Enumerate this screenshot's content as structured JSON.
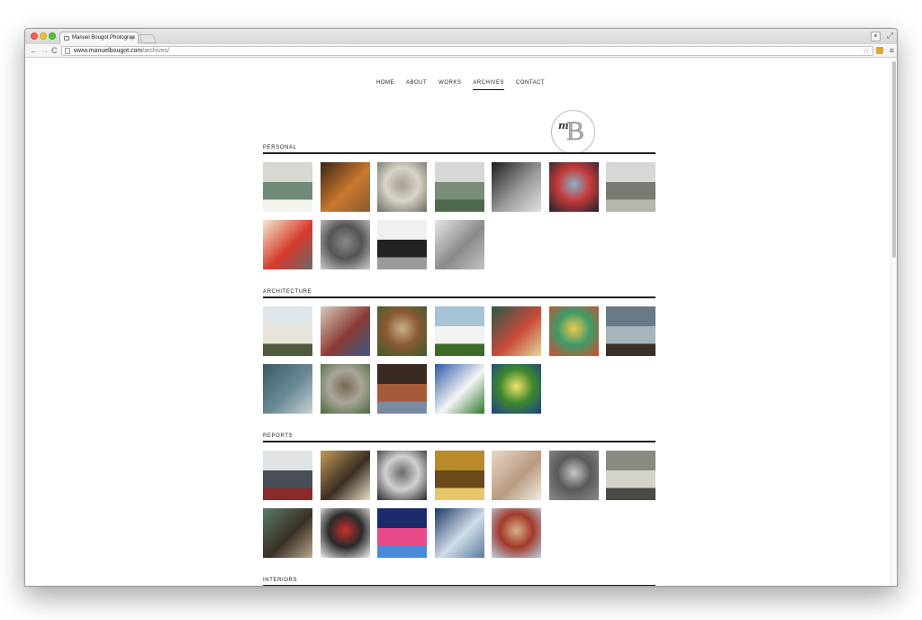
{
  "browser": {
    "tab_title": "Manuel Bougot Photograp",
    "tab_close": "×",
    "url_host": "www.manuelbougot.com",
    "url_path": "/archives/",
    "back": "←",
    "forward": "→",
    "reload": "C",
    "star": "☆",
    "menu": "≡",
    "resize": "⤢"
  },
  "site": {
    "nav": [
      "HOME",
      "ABOUT",
      "WORKS",
      "ARCHIVES",
      "CONTACT"
    ],
    "active_nav": "ARCHIVES",
    "logo_m": "m",
    "logo_b": "B"
  },
  "sections": [
    {
      "title": "PERSONAL",
      "thumbs": [
        {
          "icon": "photo-kettle",
          "colors": [
            "#d7d9d2",
            "#6f8a78",
            "#f4f4ee"
          ]
        },
        {
          "icon": "photo-shelves",
          "colors": [
            "#3a2618",
            "#c8782c",
            "#8a5a34"
          ]
        },
        {
          "icon": "photo-fridge",
          "colors": [
            "#6c6a62",
            "#d9d4c8",
            "#a29e90"
          ]
        },
        {
          "icon": "photo-lamp-field",
          "colors": [
            "#d6d8d6",
            "#7a8d78",
            "#4e6a4a"
          ]
        },
        {
          "icon": "photo-street-bw",
          "colors": [
            "#1e1e1e",
            "#9a9a9a",
            "#e0e0e0"
          ]
        },
        {
          "icon": "photo-tent-plaza",
          "colors": [
            "#1a2330",
            "#c53a3a",
            "#8ab0c8"
          ]
        },
        {
          "icon": "photo-pavilion",
          "colors": [
            "#d8d8d8",
            "#7a7a72",
            "#b6b6ae"
          ]
        },
        {
          "icon": "photo-red-building",
          "colors": [
            "#f4ead2",
            "#d63a2c",
            "#6b6b6b"
          ]
        },
        {
          "icon": "photo-crowd-bw",
          "colors": [
            "#cccccc",
            "#555555",
            "#888888"
          ]
        },
        {
          "icon": "photo-palms-bw",
          "colors": [
            "#f0f0f0",
            "#222222",
            "#9a9a9a"
          ]
        },
        {
          "icon": "photo-beach-bw",
          "colors": [
            "#e6e6e6",
            "#8a8a8a",
            "#c2c2c2"
          ]
        }
      ]
    },
    {
      "title": "ARCHITECTURE",
      "thumbs": [
        {
          "icon": "photo-modern-house",
          "colors": [
            "#dfe6ec",
            "#e9e4da",
            "#4f5a3a"
          ]
        },
        {
          "icon": "photo-arches",
          "colors": [
            "#d8ccbd",
            "#8a3a34",
            "#3a5a8a"
          ]
        },
        {
          "icon": "photo-wood-house",
          "colors": [
            "#3e5a2c",
            "#8a5a34",
            "#c9b08a"
          ]
        },
        {
          "icon": "photo-villa-garden",
          "colors": [
            "#a7c3d8",
            "#f2f2f0",
            "#3f6b2a"
          ]
        },
        {
          "icon": "photo-kiosk",
          "colors": [
            "#2a5a4a",
            "#c94a3a",
            "#e5d6a0"
          ]
        },
        {
          "icon": "photo-colorful-wall",
          "colors": [
            "#d84a2c",
            "#3e9a6a",
            "#f0c84a"
          ]
        },
        {
          "icon": "photo-corbusier",
          "colors": [
            "#6a7a86",
            "#a8b4bc",
            "#3a3028"
          ]
        },
        {
          "icon": "photo-office",
          "colors": [
            "#3a5a66",
            "#6c8a96",
            "#c8d2d6"
          ]
        },
        {
          "icon": "photo-courtyard",
          "colors": [
            "#4a6a3a",
            "#a8a69a",
            "#7a6a52"
          ]
        },
        {
          "icon": "photo-brick-house",
          "colors": [
            "#3a2a22",
            "#a45a3a",
            "#7a8aa0"
          ]
        },
        {
          "icon": "photo-white-villa",
          "colors": [
            "#2b5aa6",
            "#f4f4f4",
            "#2e7a2e"
          ]
        },
        {
          "icon": "photo-night-lamp",
          "colors": [
            "#1f3d8a",
            "#3f8a2c",
            "#f4e070"
          ]
        }
      ]
    },
    {
      "title": "REPORTS",
      "thumbs": [
        {
          "icon": "photo-gallery",
          "colors": [
            "#dfe3e6",
            "#4a4e55",
            "#8a2a2a"
          ]
        },
        {
          "icon": "photo-cathedral",
          "colors": [
            "#c69a5a",
            "#3a2e22",
            "#ebe0c6"
          ]
        },
        {
          "icon": "photo-bells",
          "colors": [
            "#2a2a2a",
            "#d0d0d0",
            "#6a6a6a"
          ]
        },
        {
          "icon": "photo-brass",
          "colors": [
            "#b88a2a",
            "#6a4a18",
            "#e8c66a"
          ]
        },
        {
          "icon": "photo-statue",
          "colors": [
            "#e8d8c8",
            "#b89a80",
            "#f2ebe2"
          ]
        },
        {
          "icon": "photo-reliefs",
          "colors": [
            "#8a8a8a",
            "#5a5a5a",
            "#c6c6c6"
          ]
        },
        {
          "icon": "photo-factory",
          "colors": [
            "#8a8a82",
            "#d4d2ca",
            "#4a4a46"
          ]
        },
        {
          "icon": "photo-facade",
          "colors": [
            "#5a7a6a",
            "#3a3026",
            "#b8a88a"
          ]
        },
        {
          "icon": "photo-lantern",
          "colors": [
            "#f2f2f2",
            "#2a2a2a",
            "#c8302a"
          ]
        },
        {
          "icon": "photo-concert",
          "colors": [
            "#1a2a6a",
            "#e84a8a",
            "#4a8ad8"
          ]
        },
        {
          "icon": "photo-sailing",
          "colors": [
            "#1e3a6a",
            "#d0dce8",
            "#5a7aa0"
          ]
        },
        {
          "icon": "photo-tower",
          "colors": [
            "#b8d2e8",
            "#a23a2a",
            "#d8b08a"
          ]
        }
      ]
    },
    {
      "title": "INTERIORS",
      "thumbs": []
    }
  ]
}
